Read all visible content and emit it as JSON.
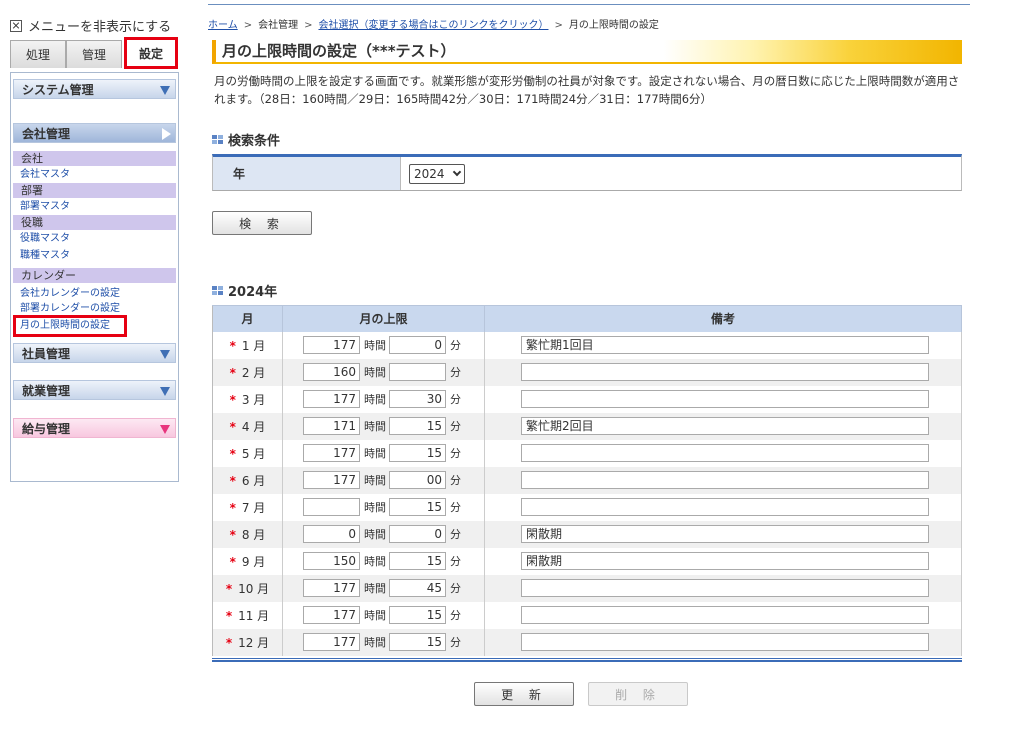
{
  "sidebar": {
    "toggle_label": "メニューを非表示にする",
    "tabs": [
      "処理",
      "管理",
      "設定"
    ],
    "sections": {
      "system": "システム管理",
      "company": "会社管理",
      "employee": "社員管理",
      "work": "就業管理",
      "salary": "給与管理"
    },
    "categories": {
      "company": "会社",
      "department": "部署",
      "position": "役職",
      "calendar": "カレンダー"
    },
    "links": {
      "company_master": "会社マスタ",
      "department_master": "部署マスタ",
      "position_master": "役職マスタ",
      "jobtype_master": "職種マスタ",
      "company_calendar": "会社カレンダーの設定",
      "department_calendar": "部署カレンダーの設定",
      "monthly_limit": "月の上限時間の設定"
    }
  },
  "breadcrumb": {
    "home": "ホーム",
    "company_admin": "会社管理",
    "company_select": "会社選択（変更する場合はこのリンクをクリック）",
    "current": "月の上限時間の設定"
  },
  "page": {
    "title": "月の上限時間の設定（***テスト）",
    "description": "月の労働時間の上限を設定する画面です。就業形態が変形労働制の社員が対象です。設定されない場合、月の暦日数に応じた上限時間数が適用されます。（28日：160時間／29日：165時間42分／30日：171時間24分／31日：177時間6分）"
  },
  "search": {
    "heading": "検索条件",
    "year_label": "年",
    "year_value": "2024",
    "button": "検 索"
  },
  "result": {
    "heading": "2024年",
    "col_month": "月",
    "col_limit": "月の上限",
    "col_note": "備考",
    "unit_hour": "時間",
    "unit_min": "分",
    "required_mark": "*",
    "rows": [
      {
        "month": "1 月",
        "hours": "177",
        "minutes": "0",
        "note": "繁忙期1回目"
      },
      {
        "month": "2 月",
        "hours": "160",
        "minutes": "",
        "note": ""
      },
      {
        "month": "3 月",
        "hours": "177",
        "minutes": "30",
        "note": ""
      },
      {
        "month": "4 月",
        "hours": "171",
        "minutes": "15",
        "note": "繁忙期2回目"
      },
      {
        "month": "5 月",
        "hours": "177",
        "minutes": "15",
        "note": ""
      },
      {
        "month": "6 月",
        "hours": "177",
        "minutes": "00",
        "note": ""
      },
      {
        "month": "7 月",
        "hours": "",
        "minutes": "15",
        "note": ""
      },
      {
        "month": "8 月",
        "hours": "0",
        "minutes": "0",
        "note": "閑散期"
      },
      {
        "month": "9 月",
        "hours": "150",
        "minutes": "15",
        "note": "閑散期"
      },
      {
        "month": "10 月",
        "hours": "177",
        "minutes": "45",
        "note": ""
      },
      {
        "month": "11 月",
        "hours": "177",
        "minutes": "15",
        "note": ""
      },
      {
        "month": "12 月",
        "hours": "177",
        "minutes": "15",
        "note": ""
      }
    ]
  },
  "actions": {
    "update": "更 新",
    "delete": "削 除"
  },
  "colors": {
    "accent_blue": "#3b6cb8",
    "highlight_red": "#e60012",
    "title_gold": "#f2b500"
  }
}
